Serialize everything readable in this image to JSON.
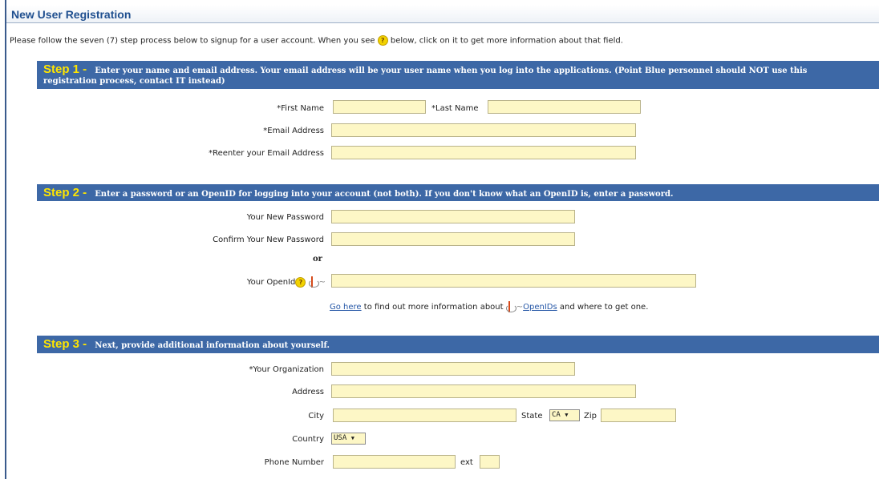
{
  "page": {
    "title": "New User Registration",
    "intro_before": "Please follow the seven (7) step process below to signup for a user account. When you see",
    "intro_after": "below, click on it to get more information about that field.",
    "help_glyph": "?"
  },
  "step1": {
    "num": "Step 1 -",
    "text_line1": "Enter your name and email address. Your email address will be your user name when you log into the applications. (Point Blue personnel should NOT use this",
    "text_line2": "registration process, contact IT instead)",
    "first_name_label": "*First Name",
    "last_name_label": "*Last Name",
    "email_label": "*Email Address",
    "reenter_email_label": "*Reenter your Email Address",
    "first_name_value": "",
    "last_name_value": "",
    "email_value": "",
    "reenter_email_value": ""
  },
  "step2": {
    "num": "Step 2 -",
    "text": "Enter a password or an OpenID for logging into your account (not both). If you don't know what an OpenID is, enter a password.",
    "password_label": "Your New Password",
    "confirm_label": "Confirm Your New Password",
    "or_label": "or",
    "openid_label": "Your OpenId",
    "openid_tilde": "~",
    "go_here_link": "Go here",
    "info_mid": "to find out more information about",
    "openids_link": "OpenIDs",
    "info_end": "and where to get one."
  },
  "step3": {
    "num": "Step 3 -",
    "text": "Next, provide additional information about yourself.",
    "organization_label": "*Your Organization",
    "address_label": "Address",
    "city_label": "City",
    "state_label": "State",
    "state_value": "CA",
    "zip_label": "Zip",
    "country_label": "Country",
    "country_value": "USA",
    "phone_label": "Phone Number",
    "ext_label": "ext"
  },
  "icons": {
    "dropdown_arrow": "▼"
  },
  "colors": {
    "step_bar": "#3d68a6",
    "step_number": "#ffe600",
    "input_bg": "#fdf7c6",
    "title": "#1f4f8f",
    "link": "#2456a6"
  }
}
